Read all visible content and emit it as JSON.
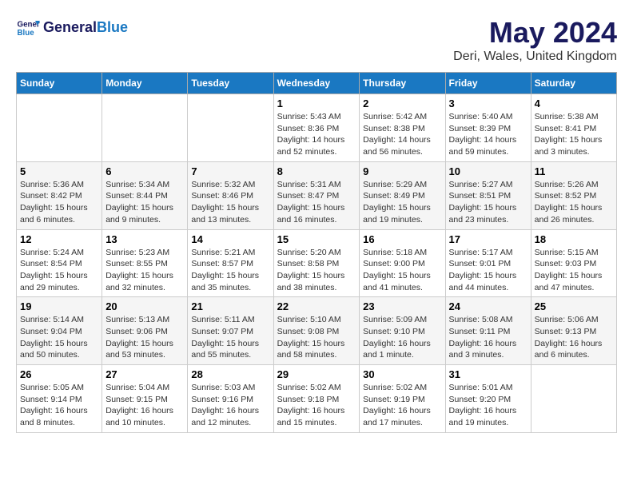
{
  "logo": {
    "line1": "General",
    "line2": "Blue"
  },
  "title": "May 2024",
  "location": "Deri, Wales, United Kingdom",
  "days_of_week": [
    "Sunday",
    "Monday",
    "Tuesday",
    "Wednesday",
    "Thursday",
    "Friday",
    "Saturday"
  ],
  "weeks": [
    [
      {
        "num": "",
        "info": ""
      },
      {
        "num": "",
        "info": ""
      },
      {
        "num": "",
        "info": ""
      },
      {
        "num": "1",
        "info": "Sunrise: 5:43 AM\nSunset: 8:36 PM\nDaylight: 14 hours and 52 minutes."
      },
      {
        "num": "2",
        "info": "Sunrise: 5:42 AM\nSunset: 8:38 PM\nDaylight: 14 hours and 56 minutes."
      },
      {
        "num": "3",
        "info": "Sunrise: 5:40 AM\nSunset: 8:39 PM\nDaylight: 14 hours and 59 minutes."
      },
      {
        "num": "4",
        "info": "Sunrise: 5:38 AM\nSunset: 8:41 PM\nDaylight: 15 hours and 3 minutes."
      }
    ],
    [
      {
        "num": "5",
        "info": "Sunrise: 5:36 AM\nSunset: 8:42 PM\nDaylight: 15 hours and 6 minutes."
      },
      {
        "num": "6",
        "info": "Sunrise: 5:34 AM\nSunset: 8:44 PM\nDaylight: 15 hours and 9 minutes."
      },
      {
        "num": "7",
        "info": "Sunrise: 5:32 AM\nSunset: 8:46 PM\nDaylight: 15 hours and 13 minutes."
      },
      {
        "num": "8",
        "info": "Sunrise: 5:31 AM\nSunset: 8:47 PM\nDaylight: 15 hours and 16 minutes."
      },
      {
        "num": "9",
        "info": "Sunrise: 5:29 AM\nSunset: 8:49 PM\nDaylight: 15 hours and 19 minutes."
      },
      {
        "num": "10",
        "info": "Sunrise: 5:27 AM\nSunset: 8:51 PM\nDaylight: 15 hours and 23 minutes."
      },
      {
        "num": "11",
        "info": "Sunrise: 5:26 AM\nSunset: 8:52 PM\nDaylight: 15 hours and 26 minutes."
      }
    ],
    [
      {
        "num": "12",
        "info": "Sunrise: 5:24 AM\nSunset: 8:54 PM\nDaylight: 15 hours and 29 minutes."
      },
      {
        "num": "13",
        "info": "Sunrise: 5:23 AM\nSunset: 8:55 PM\nDaylight: 15 hours and 32 minutes."
      },
      {
        "num": "14",
        "info": "Sunrise: 5:21 AM\nSunset: 8:57 PM\nDaylight: 15 hours and 35 minutes."
      },
      {
        "num": "15",
        "info": "Sunrise: 5:20 AM\nSunset: 8:58 PM\nDaylight: 15 hours and 38 minutes."
      },
      {
        "num": "16",
        "info": "Sunrise: 5:18 AM\nSunset: 9:00 PM\nDaylight: 15 hours and 41 minutes."
      },
      {
        "num": "17",
        "info": "Sunrise: 5:17 AM\nSunset: 9:01 PM\nDaylight: 15 hours and 44 minutes."
      },
      {
        "num": "18",
        "info": "Sunrise: 5:15 AM\nSunset: 9:03 PM\nDaylight: 15 hours and 47 minutes."
      }
    ],
    [
      {
        "num": "19",
        "info": "Sunrise: 5:14 AM\nSunset: 9:04 PM\nDaylight: 15 hours and 50 minutes."
      },
      {
        "num": "20",
        "info": "Sunrise: 5:13 AM\nSunset: 9:06 PM\nDaylight: 15 hours and 53 minutes."
      },
      {
        "num": "21",
        "info": "Sunrise: 5:11 AM\nSunset: 9:07 PM\nDaylight: 15 hours and 55 minutes."
      },
      {
        "num": "22",
        "info": "Sunrise: 5:10 AM\nSunset: 9:08 PM\nDaylight: 15 hours and 58 minutes."
      },
      {
        "num": "23",
        "info": "Sunrise: 5:09 AM\nSunset: 9:10 PM\nDaylight: 16 hours and 1 minute."
      },
      {
        "num": "24",
        "info": "Sunrise: 5:08 AM\nSunset: 9:11 PM\nDaylight: 16 hours and 3 minutes."
      },
      {
        "num": "25",
        "info": "Sunrise: 5:06 AM\nSunset: 9:13 PM\nDaylight: 16 hours and 6 minutes."
      }
    ],
    [
      {
        "num": "26",
        "info": "Sunrise: 5:05 AM\nSunset: 9:14 PM\nDaylight: 16 hours and 8 minutes."
      },
      {
        "num": "27",
        "info": "Sunrise: 5:04 AM\nSunset: 9:15 PM\nDaylight: 16 hours and 10 minutes."
      },
      {
        "num": "28",
        "info": "Sunrise: 5:03 AM\nSunset: 9:16 PM\nDaylight: 16 hours and 12 minutes."
      },
      {
        "num": "29",
        "info": "Sunrise: 5:02 AM\nSunset: 9:18 PM\nDaylight: 16 hours and 15 minutes."
      },
      {
        "num": "30",
        "info": "Sunrise: 5:02 AM\nSunset: 9:19 PM\nDaylight: 16 hours and 17 minutes."
      },
      {
        "num": "31",
        "info": "Sunrise: 5:01 AM\nSunset: 9:20 PM\nDaylight: 16 hours and 19 minutes."
      },
      {
        "num": "",
        "info": ""
      }
    ]
  ]
}
